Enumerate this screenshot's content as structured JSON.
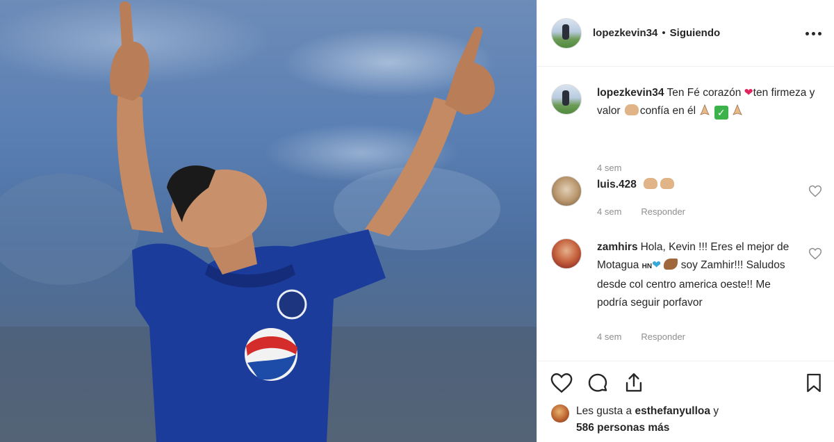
{
  "post": {
    "image_alt": "",
    "jersey_text": "pepsi"
  },
  "header": {
    "username": "lopezkevin34",
    "separator": "•",
    "follow_status": "Siguiendo"
  },
  "caption": {
    "username": "lopezkevin34",
    "text_1": "Ten Fé corazón",
    "text_2": "ten firmeza y valor",
    "text_3": "confía en él",
    "time": "4 sem"
  },
  "comments": [
    {
      "username": "luis.428",
      "text": "",
      "time": "4 sem",
      "reply_label": "Responder"
    },
    {
      "username": "zamhirs",
      "text_1": "Hola, Kevin !!! Eres el mejor de Motagua",
      "hn": "HN",
      "text_2": "soy Zamhir!!! Saludos desde col centro america oeste!! Me podría seguir porfavor",
      "time": "4 sem",
      "reply_label": "Responder"
    }
  ],
  "likes": {
    "prefix": "Les gusta a",
    "user": "esthefanyulloa",
    "mid": "y",
    "count_text": "586 personas más"
  },
  "colors": {
    "text": "#262626",
    "muted": "#8e8e8e",
    "like_red": "#e0245e",
    "jersey_blue": "#1c3c9c"
  },
  "icons": [
    "more-options-icon",
    "heart-icon",
    "comment-icon",
    "share-icon",
    "bookmark-icon",
    "check-icon",
    "red-heart-emoji",
    "flexed-arm-emoji",
    "praying-hands-emoji",
    "blue-heart-emoji"
  ]
}
